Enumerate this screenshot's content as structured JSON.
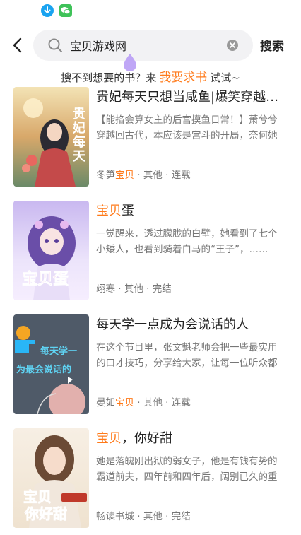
{
  "status_bar": {
    "icons": [
      "download-icon",
      "wechat-icon"
    ]
  },
  "search": {
    "query": "宝贝游戏网",
    "button_label": "搜索"
  },
  "hint": {
    "prefix": "搜不到想要的书？来",
    "link": "我要求书",
    "suffix": "试试~"
  },
  "colors": {
    "accent": "#ff7a1a",
    "search_bg": "#f2f2f4",
    "cursor_drop": "#b89cf5"
  },
  "results": [
    {
      "title": "贵妃每天只想当咸鱼|爆笑穿越宫斗",
      "desc": "【能掐会算女主的后宫摸鱼日常！】萧兮兮穿越回古代，本应该是宫斗的开局，奈何她只想当咸鱼……",
      "author_pre": "冬笋",
      "author_hl": "宝贝",
      "author_post": "",
      "category": "其他",
      "status": "连载",
      "cover_text": "贵妃每天"
    },
    {
      "title_hl": "宝贝",
      "title_post": "蛋",
      "desc": "一觉醒来，透过朦胧的白壁，她看到了七个小矮人，也看到骑着白马的“王子”，……",
      "author": "翊寒",
      "category": "其他",
      "status": "完结",
      "cover_text": "宝贝蛋"
    },
    {
      "title": "每天学一点成为会说话的人",
      "desc": "在这个节目里，张文魁老师会把一些最实用的口才技巧，分享给大家，让每一位听众都能成为会说话的人。",
      "author_pre": "晏如",
      "author_hl": "宝贝",
      "author_post": "",
      "category": "其他",
      "status": "连载",
      "cover_line1": "每天学一",
      "cover_line2": "为最会说话的"
    },
    {
      "title_hl": "宝贝",
      "title_post": "，你好甜",
      "desc": "她是落魄刚出狱的弱女子，他是有钱有势的霸道前夫，四年前和四年后，阔别已久的重逢……",
      "author": "畅读书城",
      "category": "其他",
      "status": "完结",
      "cover_line1": "宝贝",
      "cover_line2": "你好甜"
    }
  ],
  "meta_sep": " · "
}
